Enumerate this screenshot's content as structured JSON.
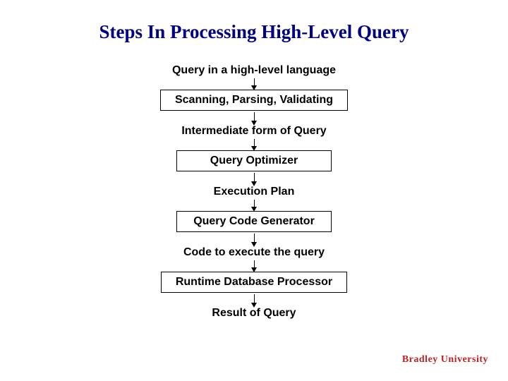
{
  "title": "Steps In Processing High-Level Query",
  "steps": {
    "s0": "Query in a high-level language",
    "b0": "Scanning, Parsing, Validating",
    "s1": "Intermediate form of Query",
    "b1": "Query Optimizer",
    "s2": "Execution Plan",
    "b2": "Query Code Generator",
    "s3": "Code to execute the query",
    "b3": "Runtime Database Processor",
    "s4": "Result of Query"
  },
  "footer": "Bradley University"
}
